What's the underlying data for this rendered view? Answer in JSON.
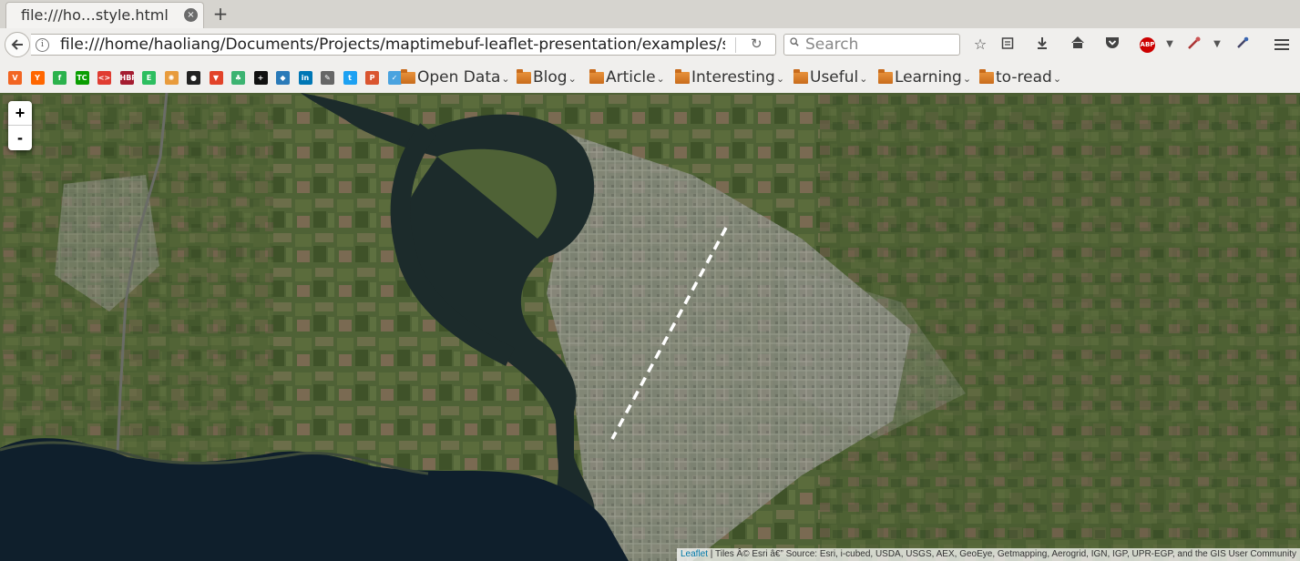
{
  "tab": {
    "title": "file:///ho…style.html",
    "close": "×",
    "new_tab": "+"
  },
  "navbar": {
    "url": "file:///home/haoliang/Documents/Projects/maptimebuf-leaflet-presentation/examples/sl",
    "info": "i",
    "search_placeholder": "Search",
    "abp_label": "ABP"
  },
  "bookmarks": {
    "sites": [
      {
        "icon": "v-icon",
        "glyph": "V",
        "color": "#f26522"
      },
      {
        "icon": "y-hackernews-icon",
        "glyph": "Y",
        "color": "#ff6600"
      },
      {
        "icon": "feedly-icon",
        "glyph": "f",
        "color": "#2bb24c"
      },
      {
        "icon": "techcrunch-icon",
        "glyph": "TC",
        "color": "#0a9e01"
      },
      {
        "icon": "code-icon",
        "glyph": "<>",
        "color": "#e03c31"
      },
      {
        "icon": "hbr-icon",
        "glyph": "HBR",
        "color": "#a51c30"
      },
      {
        "icon": "evernote-icon",
        "glyph": "E",
        "color": "#2dbe60"
      },
      {
        "icon": "badge-icon",
        "glyph": "✺",
        "color": "#e89b3c"
      },
      {
        "icon": "github-icon",
        "glyph": "●",
        "color": "#222222"
      },
      {
        "icon": "gitlab-icon",
        "glyph": "▼",
        "color": "#e24329"
      },
      {
        "icon": "leaf-icon",
        "glyph": "♣",
        "color": "#3cb371"
      },
      {
        "icon": "plus-square-icon",
        "glyph": "+",
        "color": "#111111"
      },
      {
        "icon": "diamond-icon",
        "glyph": "◆",
        "color": "#2a7ab8"
      },
      {
        "icon": "linkedin-icon",
        "glyph": "in",
        "color": "#0077b5"
      },
      {
        "icon": "feather-icon",
        "glyph": "✎",
        "color": "#666666"
      },
      {
        "icon": "twitter-icon",
        "glyph": "t",
        "color": "#1da1f2"
      },
      {
        "icon": "producthunt-icon",
        "glyph": "P",
        "color": "#da552f"
      },
      {
        "icon": "check-icon",
        "glyph": "✓",
        "color": "#4aa3df"
      }
    ],
    "folders": [
      "Open Data",
      "Blog",
      "Article",
      "Interesting",
      "Useful",
      "Learning",
      "to-read"
    ]
  },
  "map": {
    "zoom_in": "+",
    "zoom_out": "-",
    "attribution_link": "Leaflet",
    "attribution_text": " | Tiles Â© Esri â€” Source: Esri, i-cubed, USDA, USGS, AEX, GeoEye, Getmapping, Aerogrid, IGN, IGP, UPR-EGP, and the GIS User Community"
  },
  "colors": {
    "land": "#4d5f34",
    "urban": "#8d8f86",
    "water": "#1c2b2b",
    "lake": "#0f1f2c",
    "path": "#ffffff"
  }
}
